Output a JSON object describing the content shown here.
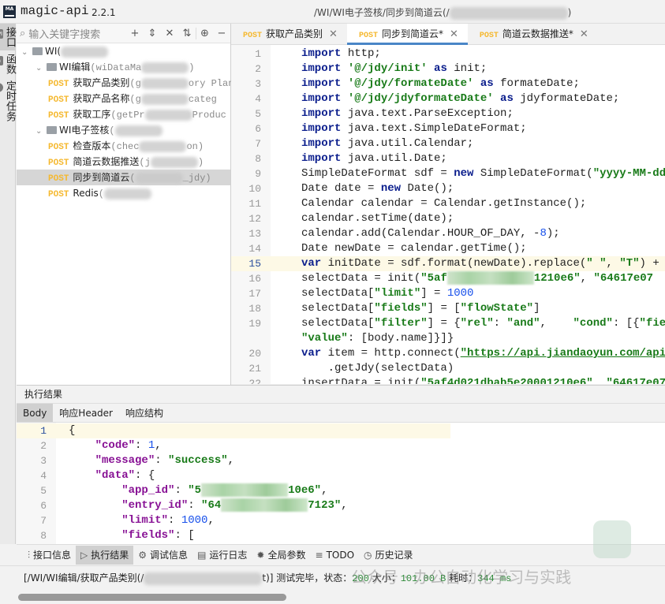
{
  "app": {
    "name": "magic-api",
    "version": "2.2.1",
    "path": "/WI/WI电子签核/同步到简道云(/"
  },
  "rail": [
    {
      "label": "接口",
      "icon": "API"
    },
    {
      "label": "函数",
      "icon": "fn"
    },
    {
      "label": "定时任务",
      "icon": "clock"
    }
  ],
  "tree": {
    "search_placeholder": "输入关键字搜索",
    "items": [
      {
        "level": 0,
        "type": "folder",
        "label": "WI(",
        "blurred": true
      },
      {
        "level": 1,
        "type": "folder",
        "label": "WI编辑",
        "paren": "(wiDataMa",
        "tail": ")"
      },
      {
        "level": 2,
        "method": "POST",
        "label": "获取产品类别",
        "paren": "(g",
        "tail": "ory   Plan"
      },
      {
        "level": 2,
        "method": "POST",
        "label": "获取产品名称",
        "paren": "(g",
        "tail": "categ"
      },
      {
        "level": 2,
        "method": "POST",
        "label": "获取工序",
        "paren": "(getPr",
        "tail": "Produc"
      },
      {
        "level": 1,
        "type": "folder",
        "label": "WI电子签核",
        "paren": "(",
        "tail": ""
      },
      {
        "level": 2,
        "method": "POST",
        "label": "检查版本",
        "paren": "(chec",
        "tail": "on)"
      },
      {
        "level": 2,
        "method": "POST",
        "label": "简道云数据推送",
        "paren": "(j",
        "tail": ")"
      },
      {
        "level": 2,
        "method": "POST",
        "label": "同步到简道云",
        "paren": "(",
        "tail": "_jdy)",
        "selected": true
      },
      {
        "level": 2,
        "method": "POST",
        "label": "Redis",
        "paren": "(",
        "tail": ""
      }
    ]
  },
  "tabs": [
    {
      "method": "POST",
      "label": "获取产品类别",
      "active": false
    },
    {
      "method": "POST",
      "label": "同步到简道云*",
      "active": true
    },
    {
      "method": "POST",
      "label": "简道云数据推送*",
      "active": false
    }
  ],
  "editor": {
    "current_line": 15,
    "lines": [
      {
        "n": "1",
        "t": [
          [
            "kw",
            "import"
          ],
          [
            "",
            "http;"
          ]
        ]
      },
      {
        "n": "2",
        "t": [
          [
            "kw",
            "import"
          ],
          [
            "str",
            "'@/jdy/init'"
          ],
          [
            "kw",
            " as"
          ],
          [
            "",
            " init;"
          ]
        ]
      },
      {
        "n": "3",
        "t": [
          [
            "kw",
            "import"
          ],
          [
            "str",
            "'@/jdy/formateDate'"
          ],
          [
            "kw",
            " as"
          ],
          [
            "",
            " formateDate;"
          ]
        ]
      },
      {
        "n": "4",
        "t": [
          [
            "kw",
            "import"
          ],
          [
            "str",
            "'@/jdy/jdyformateDate'"
          ],
          [
            "kw",
            " as"
          ],
          [
            "",
            " jdyformateDate;"
          ]
        ]
      },
      {
        "n": "5",
        "t": [
          [
            "kw",
            "import"
          ],
          [
            "",
            "java.text.ParseException;"
          ]
        ]
      },
      {
        "n": "6",
        "t": [
          [
            "kw",
            "import"
          ],
          [
            "",
            "java.text.SimpleDateFormat;"
          ]
        ]
      },
      {
        "n": "7",
        "t": [
          [
            "kw",
            "import"
          ],
          [
            "",
            "java.util.Calendar;"
          ]
        ]
      },
      {
        "n": "8",
        "t": [
          [
            "kw",
            "import"
          ],
          [
            "",
            "java.util.Date;"
          ]
        ]
      },
      {
        "n": "9",
        "t": [
          [
            "",
            "SimpleDateFormat sdf = "
          ],
          [
            "kw",
            "new"
          ],
          [
            "",
            " SimpleDateFormat("
          ],
          [
            "str",
            "\"yyyy-MM-dd"
          ]
        ]
      },
      {
        "n": "10",
        "t": [
          [
            "",
            "Date date = "
          ],
          [
            "kw",
            "new"
          ],
          [
            "",
            " Date();"
          ]
        ]
      },
      {
        "n": "11",
        "t": [
          [
            "",
            "Calendar calendar = Calendar.getInstance();"
          ]
        ]
      },
      {
        "n": "12",
        "t": [
          [
            "",
            "calendar.setTime(date);"
          ]
        ]
      },
      {
        "n": "13",
        "t": [
          [
            "",
            "calendar.add(Calendar.HOUR_OF_DAY, -"
          ],
          [
            "num",
            "8"
          ],
          [
            "",
            ");"
          ]
        ]
      },
      {
        "n": "14",
        "t": [
          [
            "",
            "Date newDate = calendar.getTime();"
          ]
        ]
      },
      {
        "n": "15",
        "t": [
          [
            "kw",
            "var"
          ],
          [
            "",
            " initDate = sdf.format(newDate).replace("
          ],
          [
            "str",
            "\" \""
          ],
          [
            "",
            ", "
          ],
          [
            "str",
            "\"T\""
          ],
          [
            "",
            ") +"
          ]
        ]
      },
      {
        "n": "16",
        "t": [
          [
            "",
            "selectData = init("
          ],
          [
            "str",
            "\"5af"
          ],
          [
            "blur",
            ""
          ],
          [
            "str",
            "1210e6\""
          ],
          [
            "",
            ", "
          ],
          [
            "str",
            "\"64617e07"
          ]
        ]
      },
      {
        "n": "17",
        "t": [
          [
            "",
            "selectData["
          ],
          [
            "str",
            "\"limit\""
          ],
          [
            "",
            "] = "
          ],
          [
            "num",
            "1000"
          ]
        ]
      },
      {
        "n": "18",
        "t": [
          [
            "",
            "selectData["
          ],
          [
            "str",
            "\"fields\""
          ],
          [
            "",
            "] = ["
          ],
          [
            "str",
            "\"flowState\""
          ],
          [
            "",
            "]"
          ]
        ]
      },
      {
        "n": "19",
        "t": [
          [
            "",
            "selectData["
          ],
          [
            "str",
            "\"filter\""
          ],
          [
            "",
            "] = {"
          ],
          [
            "str",
            "\"rel\""
          ],
          [
            "",
            ": "
          ],
          [
            "str",
            "\"and\""
          ],
          [
            "",
            ",    "
          ],
          [
            "str",
            "\"cond\""
          ],
          [
            "",
            ": [{"
          ],
          [
            "str",
            "\"fie"
          ]
        ]
      },
      {
        "n": "",
        "t": [
          [
            "str",
            "\"value\""
          ],
          [
            "",
            ": [body.name]}]}"
          ]
        ]
      },
      {
        "n": "20",
        "t": [
          [
            "kw",
            "var"
          ],
          [
            "",
            " item = http.connect("
          ],
          [
            "url",
            "\"https://api.jiandaoyun.com/api"
          ]
        ]
      },
      {
        "n": "21",
        "t": [
          [
            "",
            "    .getJdy(selectData)"
          ]
        ]
      },
      {
        "n": "22",
        "t": [
          [
            "",
            "insertData = init("
          ],
          [
            "str",
            "\"5af4d021dbab5e20001210e6\""
          ],
          [
            "",
            ", "
          ],
          [
            "str",
            "\"64617e07"
          ]
        ]
      }
    ]
  },
  "result": {
    "header": "执行结果",
    "tabs": [
      "Body",
      "响应Header",
      "响应结构"
    ],
    "active_tab": "Body",
    "lines": [
      {
        "n": "1",
        "t": [
          [
            "",
            "{"
          ]
        ]
      },
      {
        "n": "2",
        "t": [
          [
            "",
            "    "
          ],
          [
            "key",
            "\"code\""
          ],
          [
            "",
            ": "
          ],
          [
            "num",
            "1"
          ],
          [
            "",
            ","
          ]
        ]
      },
      {
        "n": "3",
        "t": [
          [
            "",
            "    "
          ],
          [
            "key",
            "\"message\""
          ],
          [
            "",
            ": "
          ],
          [
            "str",
            "\"success\""
          ],
          [
            "",
            ","
          ]
        ]
      },
      {
        "n": "4",
        "t": [
          [
            "",
            "    "
          ],
          [
            "key",
            "\"data\""
          ],
          [
            "",
            ": {"
          ]
        ]
      },
      {
        "n": "5",
        "t": [
          [
            "",
            "        "
          ],
          [
            "key",
            "\"app_id\""
          ],
          [
            "",
            ": "
          ],
          [
            "str",
            "\"5"
          ],
          [
            "blur",
            ""
          ],
          [
            "str",
            "10e6\""
          ],
          [
            "",
            ","
          ]
        ]
      },
      {
        "n": "6",
        "t": [
          [
            "",
            "        "
          ],
          [
            "key",
            "\"entry_id\""
          ],
          [
            "",
            ": "
          ],
          [
            "str",
            "\"64"
          ],
          [
            "blur",
            ""
          ],
          [
            "str",
            "7123\""
          ],
          [
            "",
            ","
          ]
        ]
      },
      {
        "n": "7",
        "t": [
          [
            "",
            "        "
          ],
          [
            "key",
            "\"limit\""
          ],
          [
            "",
            ": "
          ],
          [
            "num",
            "1000"
          ],
          [
            "",
            ","
          ]
        ]
      },
      {
        "n": "8",
        "t": [
          [
            "",
            "        "
          ],
          [
            "key",
            "\"fields\""
          ],
          [
            "",
            ": ["
          ]
        ]
      }
    ]
  },
  "bottom_tools": [
    {
      "icon": "sliders",
      "label": "接口信息",
      "active": false
    },
    {
      "icon": "play",
      "label": "执行结果",
      "active": true
    },
    {
      "icon": "bug",
      "label": "调试信息",
      "active": false
    },
    {
      "icon": "log",
      "label": "运行日志",
      "active": false
    },
    {
      "icon": "gear",
      "label": "全局参数",
      "active": false
    },
    {
      "icon": "list",
      "label": "TODO",
      "active": false
    },
    {
      "icon": "clock",
      "label": "历史记录",
      "active": false
    }
  ],
  "status": {
    "prefix": "[/WI/WI编辑/获取产品类别(/",
    "suffix": "t)]",
    "done": " 测试完毕，状态：",
    "code": "200",
    "size_label": " 大小：",
    "size": "101.00 B",
    "time_label": " 耗时：",
    "time": "344 ms"
  },
  "watermark": "公众号 · 办公自动化学习与实践"
}
